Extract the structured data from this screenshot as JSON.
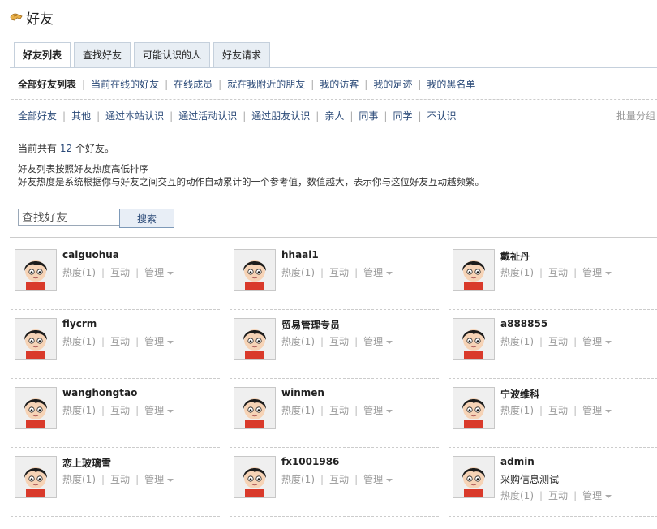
{
  "page": {
    "title": "好友"
  },
  "tabs": [
    "好友列表",
    "查找好友",
    "可能认识的人",
    "好友请求"
  ],
  "subnav": [
    "全部好友列表",
    "当前在线的好友",
    "在线成员",
    "就在我附近的朋友",
    "我的访客",
    "我的足迹",
    "我的黑名单"
  ],
  "groups": [
    "全部好友",
    "其他",
    "通过本站认识",
    "通过活动认识",
    "通过朋友认识",
    "亲人",
    "同事",
    "同学",
    "不认识"
  ],
  "batch_label": "批量分组",
  "count": {
    "prefix": "当前共有",
    "num": "12",
    "suffix": "个好友。"
  },
  "desc": {
    "line1": "好友列表按照好友热度高低排序",
    "line2": "好友热度是系统根据你与好友之间交互的动作自动累计的一个参考值，数值越大，表示你与这位好友互动越频繁。"
  },
  "search": {
    "placeholder": "查找好友",
    "button": "搜索"
  },
  "actions": {
    "heat": "热度(1)",
    "interact": "互动",
    "manage": "管理"
  },
  "friends": [
    {
      "name": "caiguohua"
    },
    {
      "name": "hhaal1"
    },
    {
      "name": "戴祉丹"
    },
    {
      "name": "flycrm"
    },
    {
      "name": "贸易管理专员"
    },
    {
      "name": "a888855"
    },
    {
      "name": "wanghongtao"
    },
    {
      "name": "winmen"
    },
    {
      "name": "宁波维科"
    },
    {
      "name": "恋上玻璃雪"
    },
    {
      "name": "fx1001986"
    },
    {
      "name": "admin",
      "extra": "采购信息测试"
    }
  ]
}
